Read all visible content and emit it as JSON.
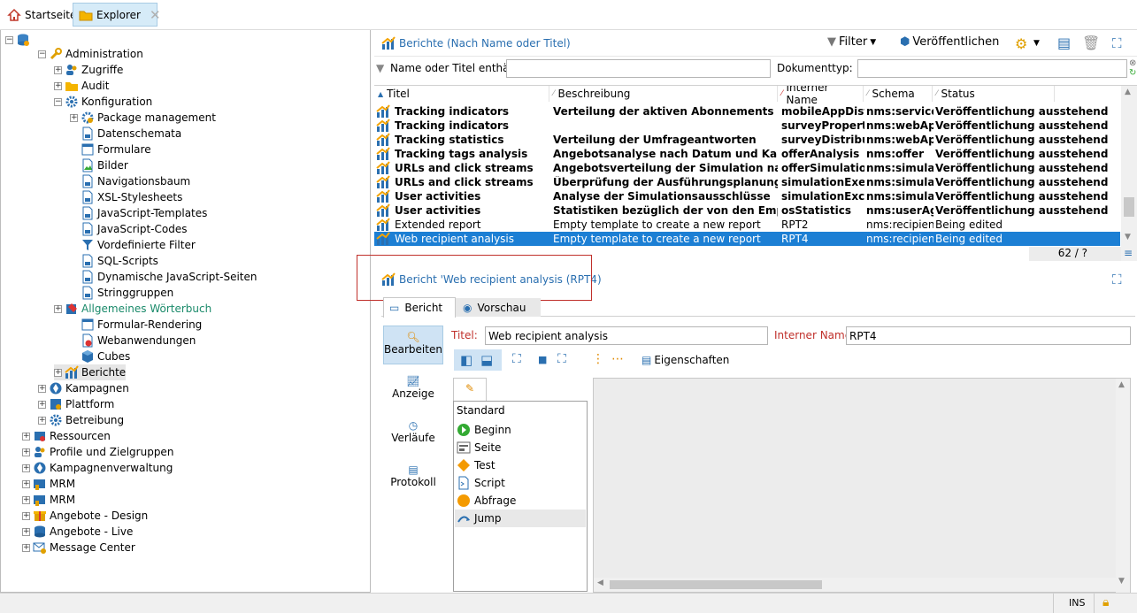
{
  "tabs": {
    "home": "Startseite",
    "explorer": "Explorer"
  },
  "tree": [
    {
      "label": "Administration"
    },
    {
      "label": "Zugriffe"
    },
    {
      "label": "Audit"
    },
    {
      "label": "Konfiguration"
    },
    {
      "label": "Package management"
    },
    {
      "label": "Datenschemata"
    },
    {
      "label": "Formulare"
    },
    {
      "label": "Bilder"
    },
    {
      "label": "Navigationsbaum"
    },
    {
      "label": "XSL-Stylesheets"
    },
    {
      "label": "JavaScript-Templates"
    },
    {
      "label": "JavaScript-Codes"
    },
    {
      "label": "Vordefinierte Filter"
    },
    {
      "label": "SQL-Scripts"
    },
    {
      "label": "Dynamische JavaScript-Seiten"
    },
    {
      "label": "Stringgruppen"
    },
    {
      "label": "Allgemeines Wörterbuch"
    },
    {
      "label": "Formular-Rendering"
    },
    {
      "label": "Webanwendungen"
    },
    {
      "label": "Cubes"
    },
    {
      "label": "Berichte"
    },
    {
      "label": "Kampagnen"
    },
    {
      "label": "Plattform"
    },
    {
      "label": "Betreibung"
    },
    {
      "label": "Ressourcen"
    },
    {
      "label": "Profile und Zielgruppen"
    },
    {
      "label": "Kampagnenverwaltung"
    },
    {
      "label": "MRM"
    },
    {
      "label": "MRM"
    },
    {
      "label": "Angebote - Design"
    },
    {
      "label": "Angebote - Live"
    },
    {
      "label": "Message Center"
    }
  ],
  "list": {
    "title": "Berichte (Nach Name oder Titel)",
    "filter": "Filter",
    "publish": "Veröffentlichen",
    "search_label": "Name oder Titel enthält:",
    "doctype_label": "Dokumenttyp:",
    "columns": [
      "Titel",
      "Beschreibung",
      "Interner Name",
      "Schema",
      "Status"
    ],
    "rows": [
      [
        "Tracking indicators",
        "Verteilung der aktiven Abonnements pro Mo...",
        "mobileAppDist...",
        "nms:service",
        "Veröffentlichung ausstehend"
      ],
      [
        "Tracking indicators",
        "",
        "surveyPropertie...",
        "nms:webApp",
        "Veröffentlichung ausstehend"
      ],
      [
        "Tracking statistics",
        "Verteilung der Umfrageantworten",
        "surveyDistribu...",
        "nms:webApp",
        "Veröffentlichung ausstehend"
      ],
      [
        "Tracking tags analysis",
        "Angebotsanalyse nach Datum und Kanal",
        "offerAnalysis",
        "nms:offer",
        "Veröffentlichung ausstehend"
      ],
      [
        "URLs and click streams",
        "Angebotsverteilung der Simulation nach Rang",
        "offerSimulation...",
        "nms:simulat...",
        "Veröffentlichung ausstehend"
      ],
      [
        "URLs and click streams",
        "Überprüfung der Ausführungsplanung mithi...",
        "simulationExecut",
        "nms:simulat...",
        "Veröffentlichung ausstehend"
      ],
      [
        "User activities",
        "Analyse der Simulationsausschlüsse",
        "simulationExclus...",
        "nms:simulat...",
        "Veröffentlichung ausstehend"
      ],
      [
        "User activities",
        "Statistiken bezüglich der von den Empfänger...",
        "osStatistics",
        "nms:userAg...",
        "Veröffentlichung ausstehend"
      ],
      [
        "Extended report",
        "Empty template to create a new report",
        "RPT2",
        "nms:recipient",
        "Being edited"
      ],
      [
        "Web recipient analysis",
        "Empty template to create a new report",
        "RPT4",
        "nms:recipient",
        "Being edited"
      ]
    ],
    "count": "62 / ?"
  },
  "detail": {
    "header": "Bericht 'Web recipient analysis (RPT4)",
    "tab_report": "Bericht",
    "tab_preview": "Vorschau",
    "side": [
      "Bearbeiten",
      "Anzeige",
      "Verläufe",
      "Protokoll"
    ],
    "title_label": "Titel:",
    "title_value": "Web recipient analysis",
    "iname_label": "Interner Name:",
    "iname_value": "RPT4",
    "properties": "Eigenschaften",
    "palette_header": "Standard",
    "palette": [
      "Beginn",
      "Seite",
      "Test",
      "Script",
      "Abfrage",
      "Jump"
    ]
  },
  "status": {
    "ins": "INS"
  }
}
